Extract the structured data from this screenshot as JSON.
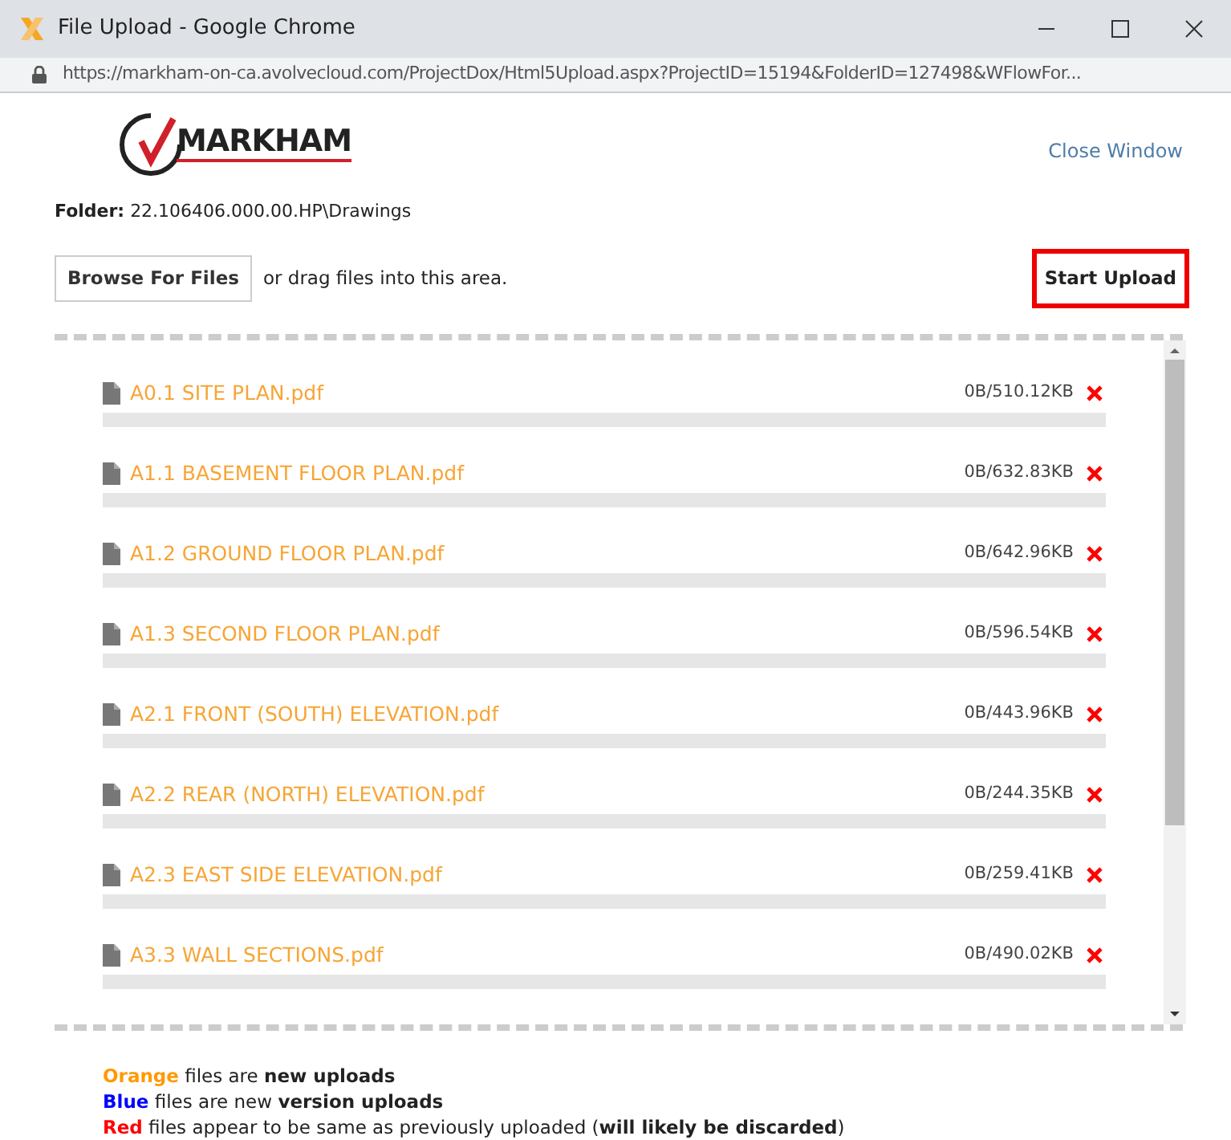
{
  "window": {
    "title": "File Upload - Google Chrome",
    "url": "https://markham-on-ca.avolvecloud.com/ProjectDox/Html5Upload.aspx?ProjectID=15194&FolderID=127498&WFlowFor..."
  },
  "logo": {
    "text": "MARKHAM"
  },
  "close_link": "Close Window",
  "folder": {
    "label": "Folder:",
    "path": "22.106406.000.00.HP\\Drawings"
  },
  "browse_button": "Browse For Files",
  "drop_hint": "or drag files into this area.",
  "start_button": "Start Upload",
  "files": [
    {
      "name": "A0.1 SITE PLAN.pdf",
      "size": "0B/510.12KB",
      "color": "#f7a536",
      "level": 0
    },
    {
      "name": "A1.1 BASEMENT FLOOR PLAN.pdf",
      "size": "0B/632.83KB",
      "color": "#f7a536",
      "level": 0
    },
    {
      "name": "A1.2 GROUND FLOOR PLAN.pdf",
      "size": "0B/642.96KB",
      "color": "#f7a536",
      "level": 0
    },
    {
      "name": "A1.3 SECOND FLOOR PLAN.pdf",
      "size": "0B/596.54KB",
      "color": "#f7a536",
      "level": 0
    },
    {
      "name": "A2.1 FRONT (SOUTH) ELEVATION.pdf",
      "size": "0B/443.96KB",
      "color": "#f7a536",
      "level": 0
    },
    {
      "name": "A2.2 REAR (NORTH) ELEVATION.pdf",
      "size": "0B/244.35KB",
      "color": "#f7a536",
      "level": 0
    },
    {
      "name": "A2.3 EAST SIDE ELEVATION.pdf",
      "size": "0B/259.41KB",
      "color": "#f7a536",
      "level": 0
    },
    {
      "name": "A3.3 WALL SECTIONS.pdf",
      "size": "0B/490.02KB",
      "color": "#f7a536",
      "level": 0
    }
  ],
  "legend": [
    {
      "text": "**Orange** files are **new uploads**",
      "color": "#ff9900"
    },
    {
      "text": "**Blue** files are new **version uploads**",
      "color": "#0000ff"
    },
    {
      "text": "**Red** files appear to be same as previously uploaded (**will likely be discarded**)",
      "color": "#ff0000"
    }
  ]
}
